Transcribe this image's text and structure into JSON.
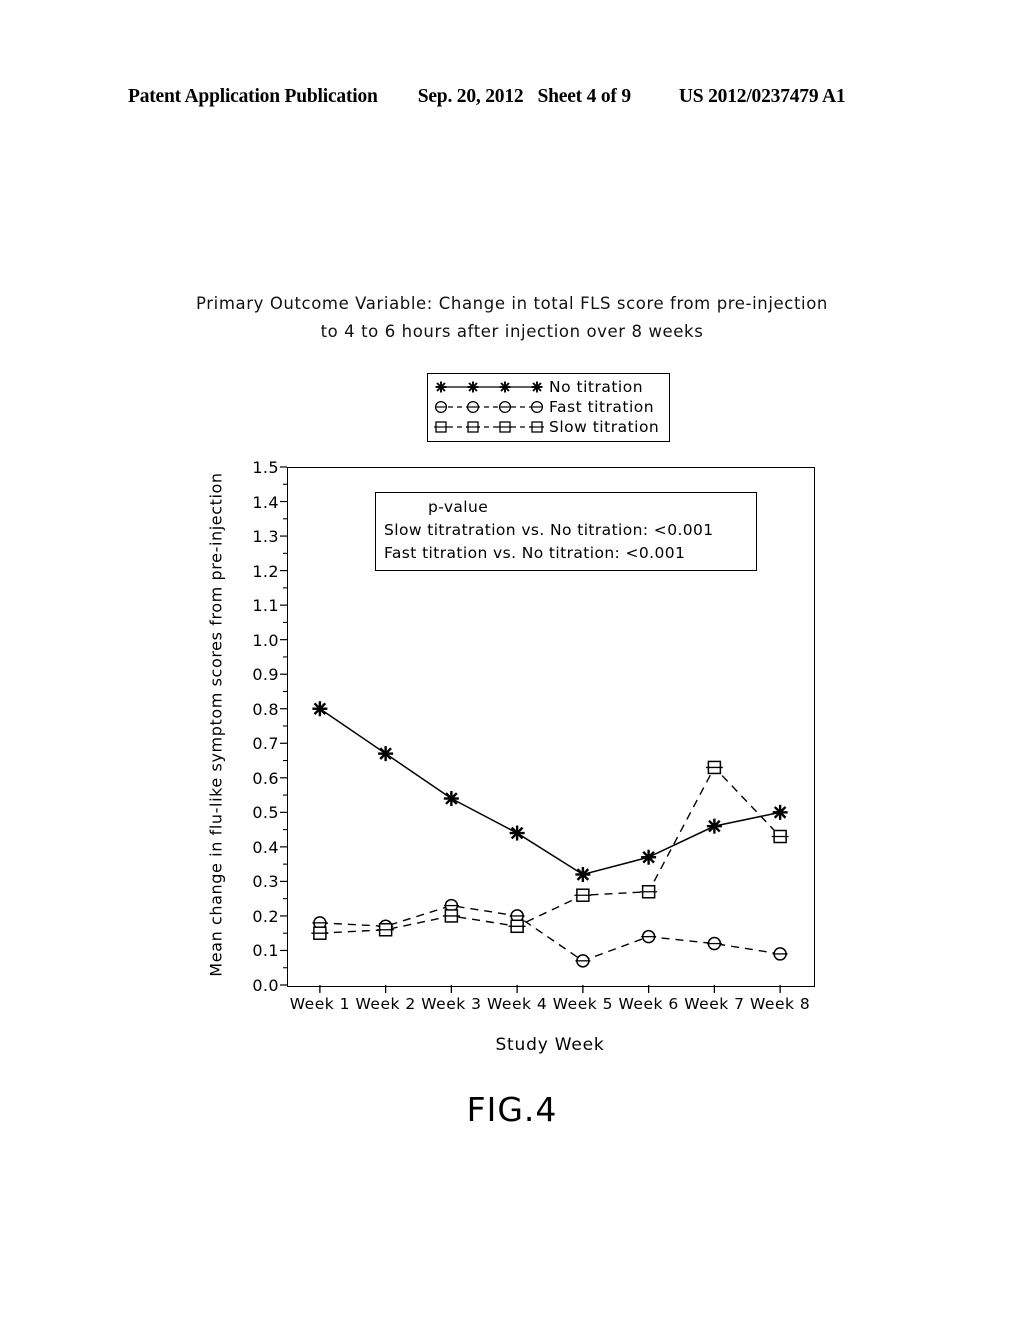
{
  "header": {
    "publication": "Patent Application Publication",
    "date": "Sep. 20, 2012",
    "sheet": "Sheet 4 of 9",
    "number": "US 2012/0237479 A1"
  },
  "figure": {
    "caption": "FIG.4"
  },
  "legend": {
    "items": [
      {
        "label": "No titration",
        "marker": "asterisk-marker-icon",
        "line": "solid"
      },
      {
        "label": "Fast titration",
        "marker": "circle-marker-icon",
        "line": "dashed"
      },
      {
        "label": "Slow titration",
        "marker": "square-marker-icon",
        "line": "dashed"
      }
    ]
  },
  "pvalue": {
    "heading": "p-value",
    "line1": "Slow titratration vs. No titration: <0.001",
    "line2": "Fast titration vs. No titration: <0.001"
  },
  "chart_data": {
    "type": "line",
    "title": "Primary Outcome Variable: Change in total FLS score from pre-injection to 4 to 6 hours after injection over 8 weeks",
    "title_line1": "Primary Outcome Variable: Change in total FLS score from pre-injection",
    "title_line2": "to 4 to 6 hours after injection over 8 weeks",
    "xlabel": "Study Week",
    "ylabel": "Mean change in flu-like symptom scores from pre-injection",
    "categories": [
      "Week 1",
      "Week 2",
      "Week 3",
      "Week 4",
      "Week 5",
      "Week 6",
      "Week 7",
      "Week 8"
    ],
    "ylim": [
      0.0,
      1.5
    ],
    "ytick_labels": [
      "1.5",
      "1.4",
      "1.3",
      "1.2",
      "1.1",
      "1.0",
      "0.9",
      "0.8",
      "0.7",
      "0.6",
      "0.5",
      "0.4",
      "0.3",
      "0.2",
      "0.1",
      "0.0"
    ],
    "ytick_values": [
      1.5,
      1.4,
      1.3,
      1.2,
      1.1,
      1.0,
      0.9,
      0.8,
      0.7,
      0.6,
      0.5,
      0.4,
      0.3,
      0.2,
      0.1,
      0.0
    ],
    "grid": false,
    "legend_position": "above-plot",
    "series": [
      {
        "name": "No titration",
        "marker": "asterisk",
        "line": "solid",
        "values": [
          0.8,
          0.67,
          0.54,
          0.44,
          0.32,
          0.37,
          0.46,
          0.5
        ]
      },
      {
        "name": "Fast titration",
        "marker": "circle",
        "line": "dashed",
        "values": [
          0.18,
          0.17,
          0.23,
          0.2,
          0.07,
          0.14,
          0.12,
          0.09
        ]
      },
      {
        "name": "Slow titration",
        "marker": "square",
        "line": "dashed",
        "values": [
          0.15,
          0.16,
          0.2,
          0.17,
          0.26,
          0.27,
          0.63,
          0.43
        ]
      }
    ]
  }
}
